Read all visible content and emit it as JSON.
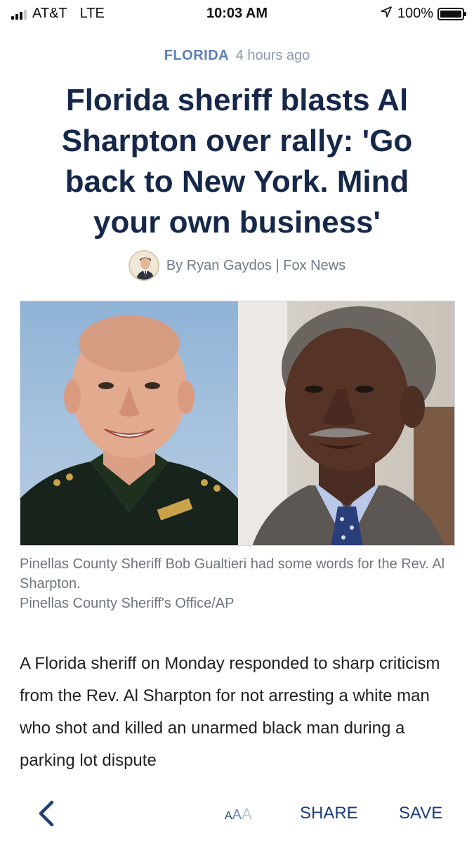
{
  "status_bar": {
    "carrier": "AT&T",
    "network": "LTE",
    "time": "10:03 AM",
    "battery": "100%",
    "battery_level": 1.0,
    "signal_bars": 3,
    "signal_max": 4,
    "icons": [
      "signal-icon",
      "location-arrow-icon",
      "battery-icon"
    ]
  },
  "article": {
    "category": "FLORIDA",
    "time_ago": "4 hours ago",
    "headline": "Florida sheriff blasts Al Sharpton over rally: 'Go back to New York. Mind your own business'",
    "byline": "By Ryan Gaydos | Fox News",
    "caption": {
      "line1": "Pinellas County Sheriff Bob Gualtieri had some words for the Rev. Al Sharpton.",
      "credit": "Pinellas County Sheriff's Office/AP"
    },
    "body": "A Florida sheriff on Monday responded to sharp criticism from the Rev. Al Sharpton for not arresting a white man who shot and killed an unarmed black man during a parking lot dispute"
  },
  "toolbar": {
    "font_size_label": "AAA",
    "share_label": "SHARE",
    "save_label": "SAVE",
    "icons": [
      "chevron-left-icon"
    ]
  },
  "colors": {
    "accent": "#1e3f7a",
    "category": "#5c7fb6",
    "headline": "#16284a",
    "body_text": "#1d1f23",
    "muted": "#6f7680"
  }
}
